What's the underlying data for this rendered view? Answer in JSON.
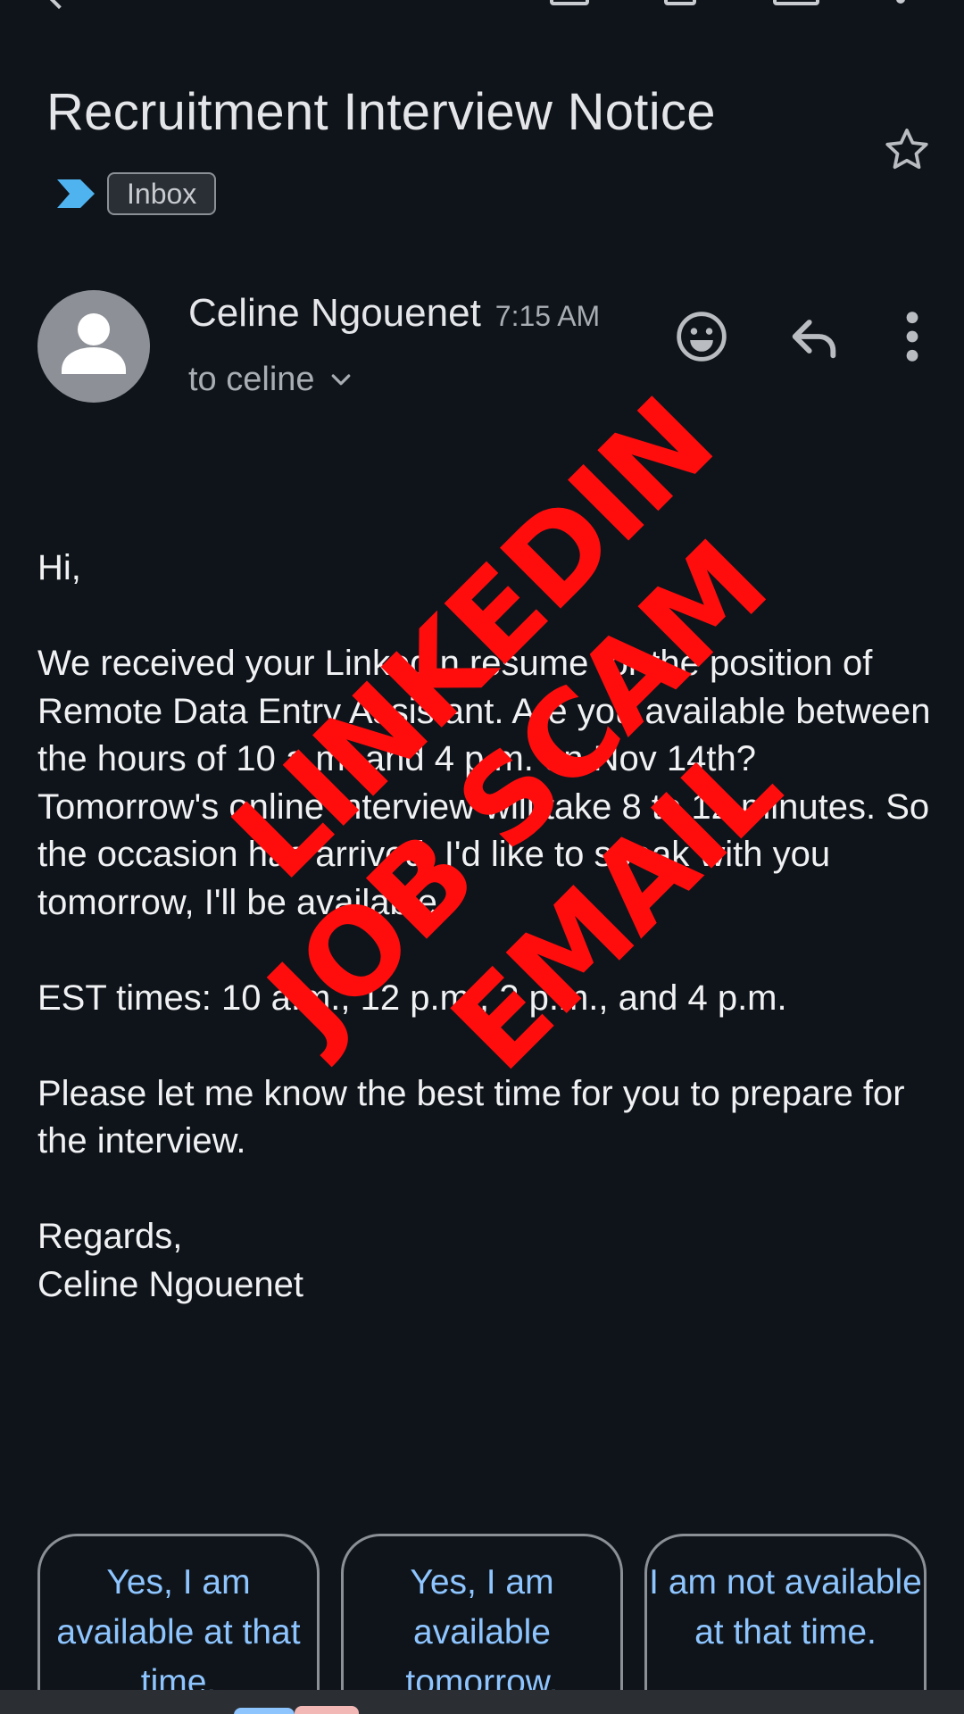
{
  "toolbar": {
    "icons": [
      "back-arrow-icon",
      "archive-icon",
      "delete-icon",
      "mail-icon",
      "more-vert-icon"
    ]
  },
  "email": {
    "subject": "Recruitment Interview Notice",
    "label": "Inbox",
    "sender_name": "Celine Ngouenet",
    "time": "7:15 AM",
    "recipient": "to celine",
    "body_paragraphs": [
      "Hi,",
      "We received your LinkedIn resume for the position of Remote Data Entry Assistant. Are you available between the hours of 10 a.m. and 4 p.m. on Nov 14th? Tomorrow's online interview will take 8 to 12 minutes. So the occasion has arrived. I'd like to speak with you tomorrow, I'll be available.",
      "EST times: 10 a.m., 12 p.m., 2 p.m., and 4 p.m.",
      "Please let me know the best time for you to prepare for the interview.",
      "Regards,\nCeline Ngouenet"
    ]
  },
  "watermark": {
    "line1": "LINKEDIN",
    "line2": "JOB SCAM",
    "line3": "EMAIL",
    "color": "#ff0d0d"
  },
  "smart_replies": [
    "Yes, I am available at that time.",
    "Yes, I am available tomorrow.",
    "I am not available at that time."
  ],
  "colors": {
    "background": "#0f141a",
    "accent_reply": "#8ec5ff",
    "label_arrow": "#4fb3f0"
  }
}
